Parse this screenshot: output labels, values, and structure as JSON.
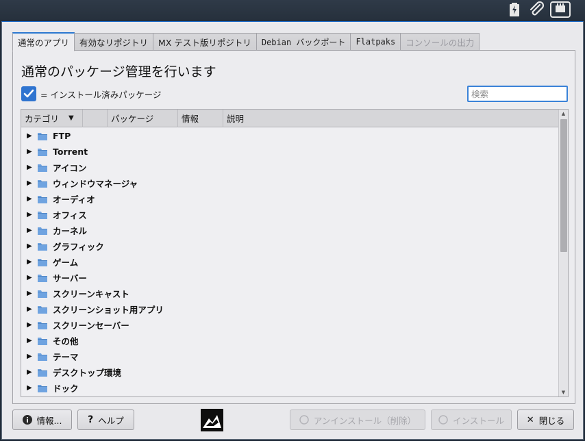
{
  "tabs": [
    {
      "label": "通常のアプリ",
      "state": "active"
    },
    {
      "label": "有効なリポジトリ",
      "state": "normal"
    },
    {
      "label": "MX テスト版リポジトリ",
      "state": "normal"
    },
    {
      "label": "Debian バックポート",
      "state": "normal"
    },
    {
      "label": "Flatpaks",
      "state": "normal"
    },
    {
      "label": "コンソールの出力",
      "state": "disabled"
    }
  ],
  "main": {
    "heading": "通常のパッケージ管理を行います",
    "legend_text": "= インストール済みパッケージ",
    "search_placeholder": "検索"
  },
  "tree": {
    "columns": [
      "カテゴリ",
      "",
      "パッケージ",
      "情報",
      "説明"
    ],
    "sort_indicator": "▼",
    "rows": [
      "FTP",
      "Torrent",
      "アイコン",
      "ウィンドウマネージャ",
      "オーディオ",
      "オフィス",
      "カーネル",
      "グラフィック",
      "ゲーム",
      "サーバー",
      "スクリーンキャスト",
      "スクリーンショット用アプリ",
      "スクリーンセーバー",
      "その他",
      "テーマ",
      "デスクトップ環境",
      "ドック"
    ]
  },
  "buttons": {
    "info": "情報...",
    "help": "ヘルプ",
    "uninstall": "アンインストール（削除）",
    "install": "インストール",
    "close": "閉じる"
  },
  "colors": {
    "accent": "#2f74d0",
    "folder": "#6fa3e0"
  },
  "icons": {
    "tray": [
      "battery-charging-icon",
      "paperclip-icon",
      "network-icon"
    ],
    "logo": "mx-logo-icon"
  }
}
